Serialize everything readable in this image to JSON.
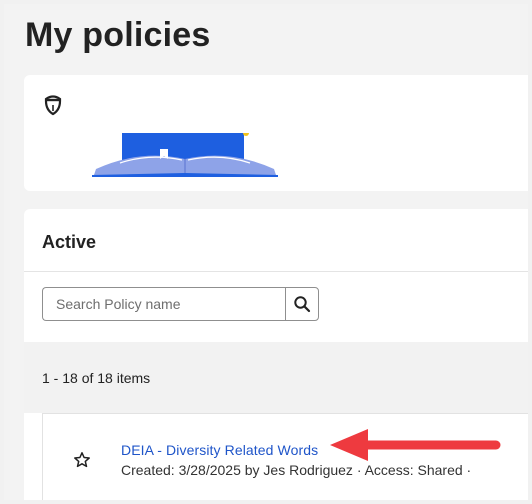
{
  "page": {
    "title": "My policies"
  },
  "hero": {
    "icon": "shield-icon",
    "illustration": "open-book-illustration"
  },
  "active": {
    "title": "Active",
    "search": {
      "placeholder": "Search Policy name",
      "value": "",
      "button_icon": "search-icon"
    },
    "items_count": "1 - 18 of 18 items",
    "rows": [
      {
        "name": "DEIA - Diversity Related Words",
        "meta": "Created: 3/28/2025 by Jes Rodriguez · Access: Shared ·",
        "favorite_icon": "star-outline-icon"
      }
    ]
  },
  "annotation": {
    "arrow_color": "#ee3a3f",
    "type": "arrow-pointing-left"
  },
  "colors": {
    "link": "#1f55c9",
    "book_blue": "#1e5fe0",
    "book_light": "#8ea3e8"
  }
}
